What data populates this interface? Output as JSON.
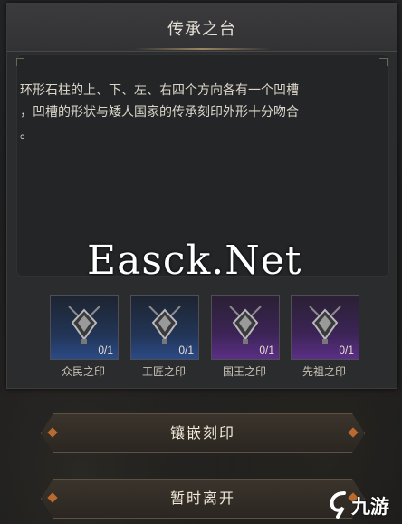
{
  "dialog": {
    "title": "传承之台",
    "description_line1": "环形石柱的上、下、左、右四个方向各有一个凹槽",
    "description_line2": "，凹槽的形状与矮人国家的传承刻印外形十分吻合",
    "description_line3": "。"
  },
  "watermark": "Easck.Net",
  "seals": [
    {
      "label": "众民之印",
      "count": "0/1",
      "rarity_color": "#2b4a85",
      "icon": "seal-emblem-icon"
    },
    {
      "label": "工匠之印",
      "count": "0/1",
      "rarity_color": "#2b4a85",
      "icon": "seal-emblem-icon"
    },
    {
      "label": "国王之印",
      "count": "0/1",
      "rarity_color": "#5b2f86",
      "icon": "seal-emblem-icon"
    },
    {
      "label": "先祖之印",
      "count": "0/1",
      "rarity_color": "#5b2f86",
      "icon": "seal-emblem-icon"
    }
  ],
  "buttons": {
    "inlay": "镶嵌刻印",
    "leave": "暂时离开"
  },
  "logo": {
    "text": "九游",
    "icon": "jiuyou-logo-icon"
  }
}
